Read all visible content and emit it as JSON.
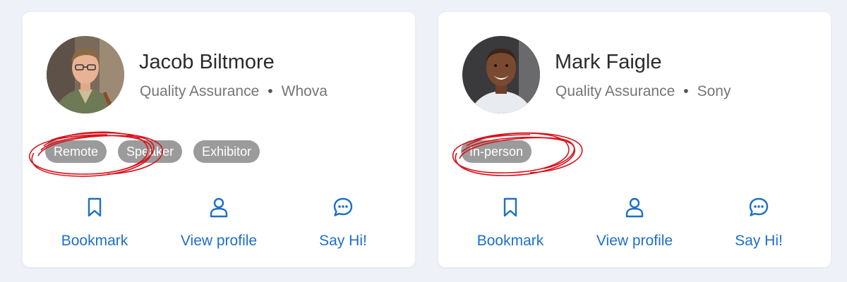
{
  "colors": {
    "accent": "#1d6fc9",
    "tag_bg": "#9b9b9b",
    "annotation": "#d8111b"
  },
  "cards": [
    {
      "name": "Jacob Biltmore",
      "role": "Quality Assurance",
      "separator": "•",
      "company": "Whova",
      "tags": [
        "Remote",
        "Speaker",
        "Exhibitor"
      ],
      "actions": {
        "bookmark": "Bookmark",
        "view_profile": "View profile",
        "say_hi": "Say Hi!"
      }
    },
    {
      "name": "Mark Faigle",
      "role": "Quality Assurance",
      "separator": "•",
      "company": "Sony",
      "tags": [
        "In-person"
      ],
      "actions": {
        "bookmark": "Bookmark",
        "view_profile": "View profile",
        "say_hi": "Say Hi!"
      }
    }
  ]
}
